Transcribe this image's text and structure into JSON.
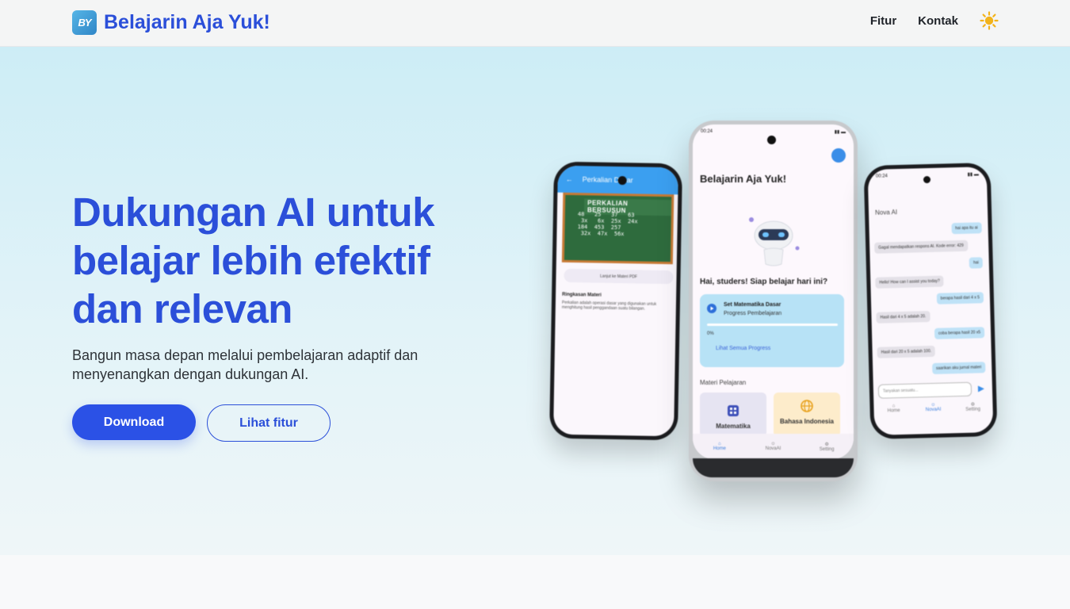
{
  "brand": {
    "name": "Belajarin Aja Yuk!",
    "logo_text": "BY"
  },
  "nav": {
    "items": [
      "Fitur",
      "Kontak"
    ],
    "theme_icon": "sun-icon"
  },
  "hero": {
    "headline": "Dukungan AI untuk belajar lebih efektif dan relevan",
    "subtext": "Bangun masa depan melalui pembelajaran adaptif dan menyenangkan dengan dukungan AI.",
    "primary_button": "Download",
    "secondary_button": "Lihat fitur"
  },
  "phones": {
    "left": {
      "header": "Perkalian Dasar",
      "board_title": "PERKALIAN BERSUSUN",
      "board_numbers": "48   25   37   63\n 3x   6x  25x  24x\n184  453  257\n 32x  47x  56x",
      "pdf_button": "Lanjut ke Materi PDF",
      "summary_title": "Ringkasan Materi",
      "summary_text": "Perkalian adalah operasi dasar yang digunakan untuk menghitung hasil penggandaan suatu bilangan."
    },
    "center": {
      "time": "00:24",
      "app_title": "Belajarin Aja Yuk!",
      "greeting": "Hai, studers! Siap belajar hari ini?",
      "card_title": "Set Matematika Dasar",
      "card_subtitle": "Progress Pembelajaran",
      "card_percent": "0%",
      "card_link": "Lihat Semua Progress",
      "section": "Materi Pelajaran",
      "tile1": "Matematika",
      "tile2": "Bahasa Indonesia",
      "nav": [
        "Home",
        "NovaAI",
        "Setting"
      ]
    },
    "right": {
      "time": "00:24",
      "title": "Nova AI",
      "messages": [
        {
          "from": "me",
          "text": "hai apa itu ai"
        },
        {
          "from": "ai",
          "text": "Gagal mendapatkan respons AI. Kode error: 429"
        },
        {
          "from": "me",
          "text": "hai"
        },
        {
          "from": "ai",
          "text": "Hello! How can I assist you today?"
        },
        {
          "from": "me",
          "text": "berapa hasil dari 4 x 5"
        },
        {
          "from": "ai",
          "text": "Hasil dari 4 x 5 adalah 20."
        },
        {
          "from": "me",
          "text": "coba berapa hasil 20 x5"
        },
        {
          "from": "ai",
          "text": "Hasil dari 20 x 5 adalah 100."
        },
        {
          "from": "me",
          "text": "saarikan aku jurnal materi"
        }
      ],
      "input_placeholder": "Tanyakan sesuatu...",
      "nav": [
        "Home",
        "NovaAI",
        "Setting"
      ]
    }
  },
  "colors": {
    "accent": "#2b4fd9",
    "button": "#2b51e6",
    "sun": "#f2b31b"
  }
}
